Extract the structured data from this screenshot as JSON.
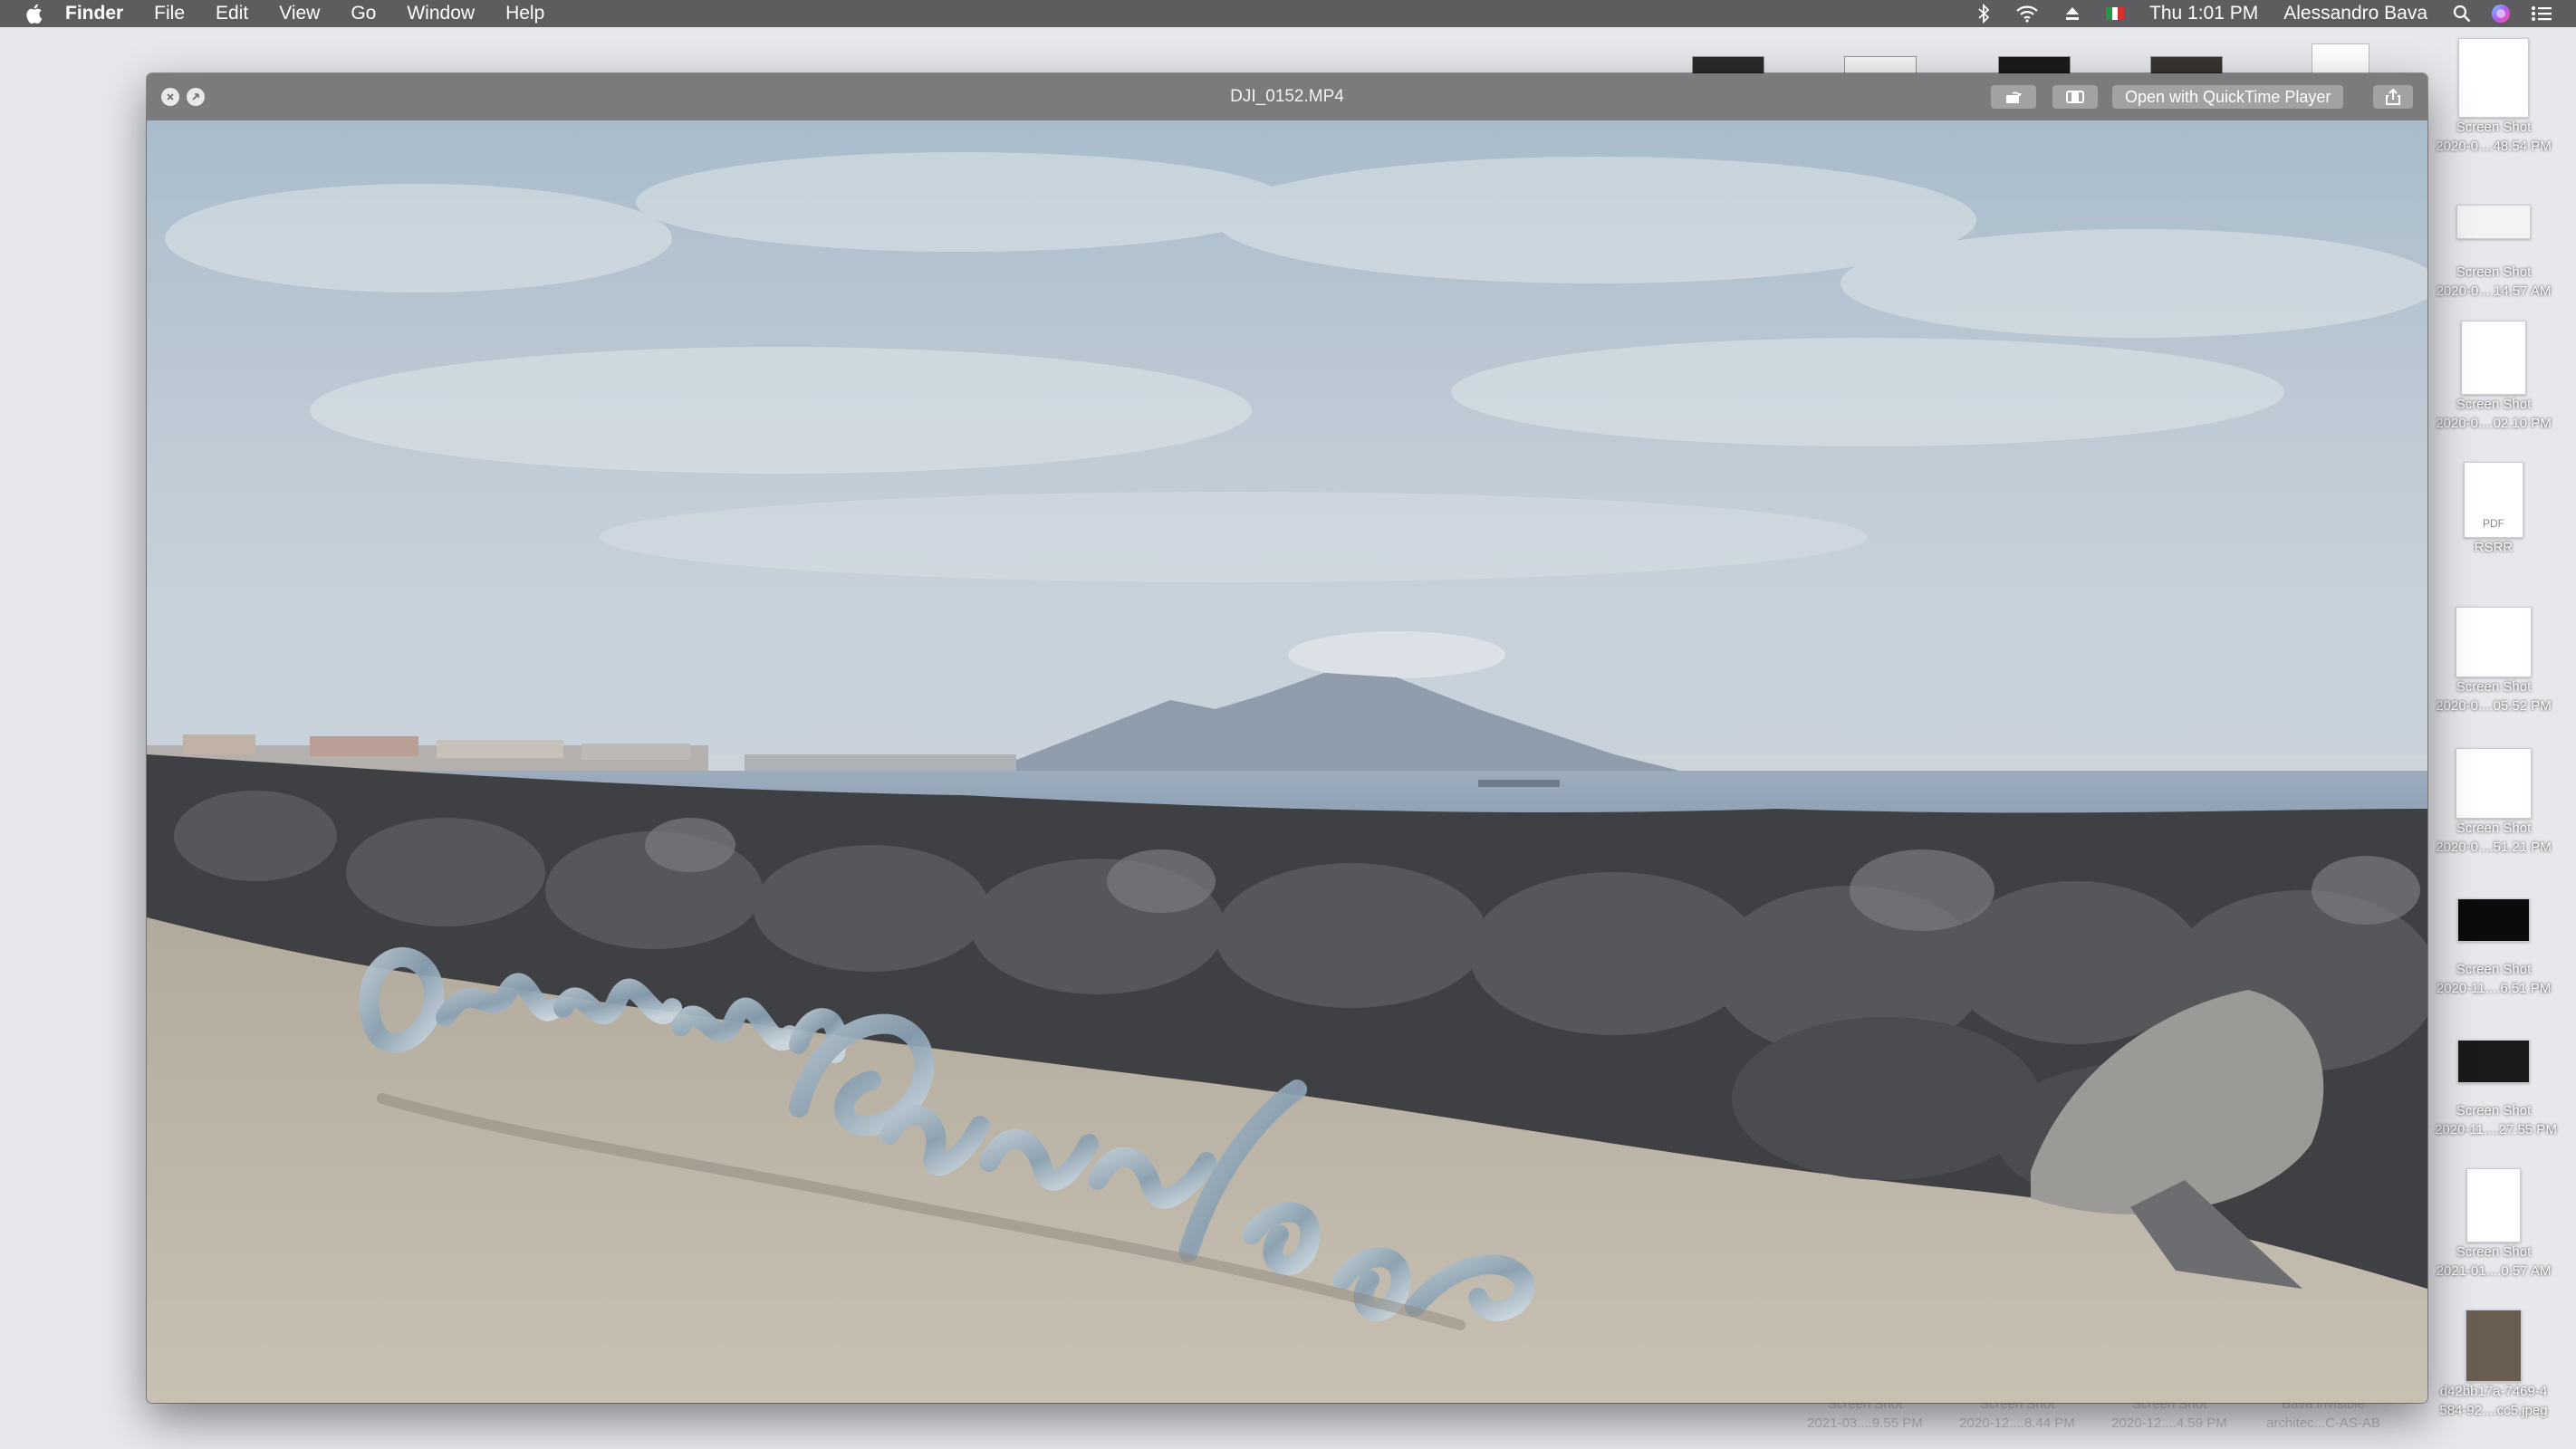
{
  "menubar": {
    "apple_icon": "apple-logo-icon",
    "app_name": "Finder",
    "menus": [
      "File",
      "Edit",
      "View",
      "Go",
      "Window",
      "Help"
    ],
    "status_icons": [
      "bluetooth-icon",
      "wifi-icon",
      "eject-icon",
      "italian-flag-icon"
    ],
    "clock": "Thu 1:01 PM",
    "user": "Alessandro Bava",
    "right_icons": [
      "spotlight-search-icon",
      "siri-icon",
      "notification-center-icon"
    ]
  },
  "quicklook": {
    "title": "DJI_0152.MP4",
    "open_button": "Open with QuickTime Player",
    "buttons": [
      "rotate-icon",
      "trim-icon",
      "share-icon"
    ]
  },
  "desktop": {
    "side_files": [
      {
        "line1": "Screen Shot",
        "line2": "2020-0....48.54 PM"
      },
      {
        "line1": "Screen Shot",
        "line2": "2020-0....14.57 AM"
      },
      {
        "line1": "Screen Shot",
        "line2": "2020-0....02.10 PM"
      },
      {
        "line1": "RSRR",
        "line2": "",
        "badge": "PDF"
      },
      {
        "line1": "Screen Shot",
        "line2": "2020-0....05.52 PM"
      },
      {
        "line1": "Screen Shot",
        "line2": "2020-0....51.21 PM"
      },
      {
        "line1": "Screen Shot",
        "line2": "2020-11....6.51 PM"
      },
      {
        "line1": "Screen Shot",
        "line2": "2020-11....27.55 PM"
      },
      {
        "line1": "Screen Shot",
        "line2": "2021-01....0.57 AM"
      },
      {
        "line1": "d42bb17a-7469-4",
        "line2": "584-92....cc5.jpeg"
      }
    ],
    "bottom_files": [
      {
        "line1": "Screen Shot",
        "line2": "2021-03....9.55 PM"
      },
      {
        "line1": "Screen Shot",
        "line2": "2020-12....8.44 PM"
      },
      {
        "line1": "Screen Shot",
        "line2": "2020-12....4.59 PM"
      },
      {
        "line1": "Bava invisible",
        "line2": "architec...C-AS-AB"
      }
    ]
  },
  "video": {
    "sculpture_text": "Ombrumetamvel"
  },
  "colors": {
    "menubar": "#5d5d5f",
    "titlebar": "#7b7b7d",
    "desktop": "#e6e8ec",
    "sky": "#b8c6d3",
    "sand": "#bcb4a6",
    "rocks": "#3d3e40"
  }
}
